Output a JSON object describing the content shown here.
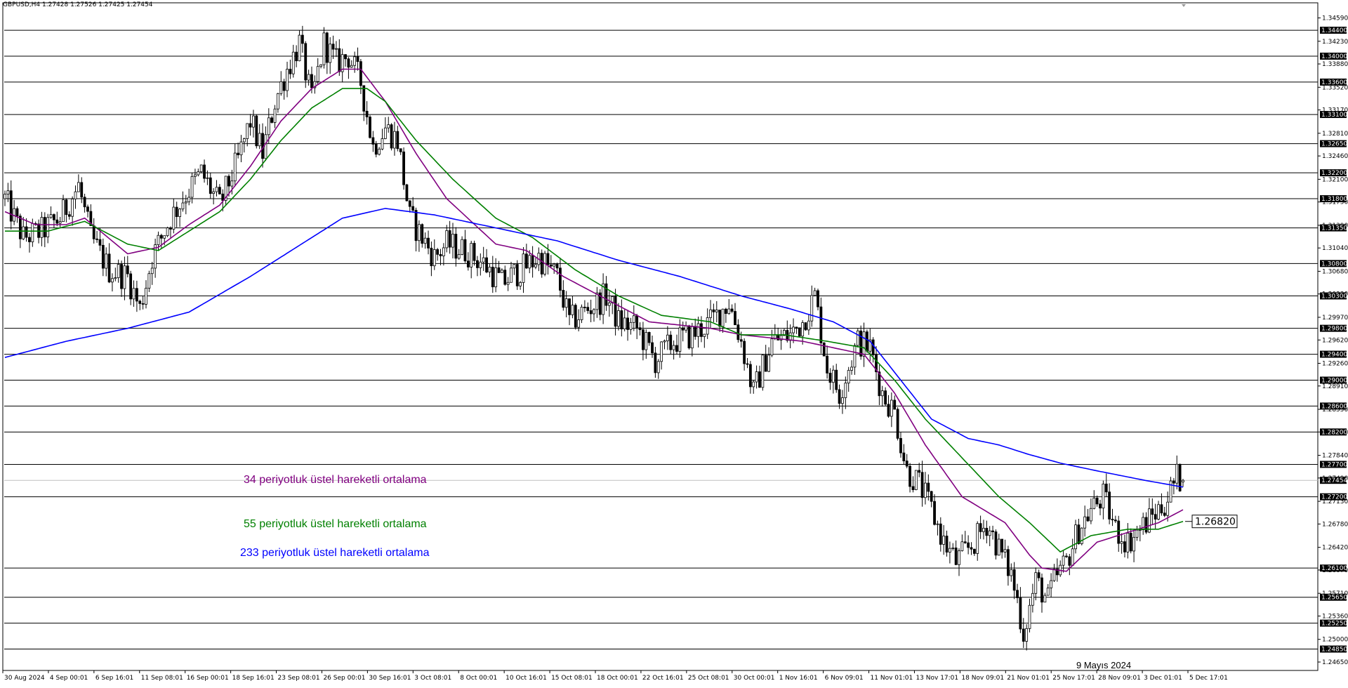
{
  "header": {
    "symbol_line": "GBPUSD,H4  1.27428 1.27526 1.27425 1.27454"
  },
  "annotations": {
    "ema34_label": "34 periyotluk üstel hareketli ortalama",
    "ema55_label": "55 periyotluk üstel hareketli ortalama",
    "ema233_label": "233 periyotluk üstel hareketli ortalama",
    "date_note": "9 Mayıs 2024",
    "price_box": "1.26820"
  },
  "colors": {
    "ema34": "#800080",
    "ema55": "#008000",
    "ema233": "#0000ff",
    "candles": "#000000",
    "grid": "#000000",
    "background": "#ffffff"
  },
  "chart_data": {
    "type": "candlestick",
    "instrument": "GBPUSD",
    "timeframe": "H4",
    "last_quote": {
      "open": 1.27428,
      "high": 1.27526,
      "low": 1.27425,
      "close": 1.27454
    },
    "ylim": [
      1.2465,
      1.3465
    ],
    "y_ticks": [
      "1.34590",
      "1.34230",
      "1.33880",
      "1.33520",
      "1.33170",
      "1.32810",
      "1.32460",
      "1.32100",
      "1.31750",
      "1.31390",
      "1.31040",
      "1.30680",
      "1.30330",
      "1.29970",
      "1.29620",
      "1.29260",
      "1.28910",
      "1.28550",
      "1.28200",
      "1.27840",
      "1.27490",
      "1.27130",
      "1.26780",
      "1.26420",
      "1.26070",
      "1.25710",
      "1.25360",
      "1.25000",
      "1.24650"
    ],
    "level_lines": [
      "1.34400",
      "1.34000",
      "1.33600",
      "1.33100",
      "1.32650",
      "1.32200",
      "1.31800",
      "1.31350",
      "1.30800",
      "1.30300",
      "1.29800",
      "1.29400",
      "1.29000",
      "1.28600",
      "1.28200",
      "1.27700",
      "1.27200",
      "1.26100",
      "1.25650",
      "1.25250",
      "1.24850"
    ],
    "current_price": "1.27454",
    "x_labels": [
      "30 Aug 2024",
      "4 Sep 00:01",
      "6 Sep 16:01",
      "11 Sep 08:01",
      "16 Sep 00:01",
      "18 Sep 16:01",
      "23 Sep 08:01",
      "26 Sep 00:01",
      "30 Sep 16:01",
      "3 Oct 08:01",
      "8 Oct 00:01",
      "10 Oct 16:01",
      "15 Oct 08:01",
      "18 Oct 00:01",
      "22 Oct 16:01",
      "25 Oct 08:01",
      "30 Oct 00:01",
      "1 Nov 16:01",
      "6 Nov 09:01",
      "11 Nov 01:01",
      "13 Nov 17:01",
      "18 Nov 09:01",
      "21 Nov 01:01",
      "25 Nov 17:01",
      "28 Nov 09:01",
      "3 Dec 01:01",
      "5 Dec 17:01"
    ],
    "close_path": [
      [
        0,
        1.318
      ],
      [
        6,
        1.312
      ],
      [
        12,
        1.313
      ],
      [
        18,
        1.315
      ],
      [
        24,
        1.32
      ],
      [
        28,
        1.312
      ],
      [
        34,
        1.307
      ],
      [
        40,
        1.306
      ],
      [
        44,
        1.301
      ],
      [
        48,
        1.309
      ],
      [
        54,
        1.315
      ],
      [
        58,
        1.318
      ],
      [
        64,
        1.322
      ],
      [
        70,
        1.317
      ],
      [
        76,
        1.324
      ],
      [
        80,
        1.33
      ],
      [
        84,
        1.325
      ],
      [
        88,
        1.333
      ],
      [
        92,
        1.338
      ],
      [
        96,
        1.342
      ],
      [
        100,
        1.333
      ],
      [
        104,
        1.342
      ],
      [
        108,
        1.339
      ],
      [
        112,
        1.34
      ],
      [
        116,
        1.336
      ],
      [
        120,
        1.326
      ],
      [
        124,
        1.329
      ],
      [
        128,
        1.327
      ],
      [
        132,
        1.315
      ],
      [
        136,
        1.312
      ],
      [
        140,
        1.309
      ],
      [
        144,
        1.311
      ],
      [
        150,
        1.31
      ],
      [
        156,
        1.308
      ],
      [
        162,
        1.305
      ],
      [
        168,
        1.307
      ],
      [
        174,
        1.309
      ],
      [
        180,
        1.306
      ],
      [
        184,
        1.299
      ],
      [
        190,
        1.301
      ],
      [
        196,
        1.303
      ],
      [
        200,
        1.299
      ],
      [
        206,
        1.298
      ],
      [
        212,
        1.293
      ],
      [
        218,
        1.296
      ],
      [
        224,
        1.297
      ],
      [
        230,
        1.299
      ],
      [
        236,
        1.302
      ],
      [
        240,
        1.296
      ],
      [
        244,
        1.288
      ],
      [
        250,
        1.296
      ],
      [
        256,
        1.297
      ],
      [
        260,
        1.299
      ],
      [
        264,
        1.303
      ],
      [
        268,
        1.292
      ],
      [
        272,
        1.288
      ],
      [
        278,
        1.296
      ],
      [
        282,
        1.295
      ],
      [
        286,
        1.288
      ],
      [
        290,
        1.285
      ],
      [
        294,
        1.276
      ],
      [
        298,
        1.274
      ],
      [
        302,
        1.27
      ],
      [
        306,
        1.265
      ],
      [
        310,
        1.262
      ],
      [
        316,
        1.265
      ],
      [
        320,
        1.268
      ],
      [
        324,
        1.264
      ],
      [
        328,
        1.26
      ],
      [
        330,
        1.256
      ],
      [
        332,
        1.251
      ],
      [
        336,
        1.259
      ],
      [
        340,
        1.256
      ],
      [
        342,
        1.259
      ],
      [
        346,
        1.262
      ],
      [
        350,
        1.267
      ],
      [
        354,
        1.27
      ],
      [
        358,
        1.272
      ],
      [
        362,
        1.267
      ],
      [
        366,
        1.265
      ],
      [
        370,
        1.267
      ],
      [
        374,
        1.269
      ],
      [
        378,
        1.271
      ],
      [
        382,
        1.275
      ],
      [
        384,
        1.2745
      ]
    ],
    "series": [
      {
        "name": "34 periyotluk üstel hareketli ortalama",
        "color": "#800080",
        "values": [
          [
            0,
            1.316
          ],
          [
            10,
            1.314
          ],
          [
            20,
            1.314
          ],
          [
            26,
            1.315
          ],
          [
            40,
            1.3095
          ],
          [
            50,
            1.3105
          ],
          [
            60,
            1.314
          ],
          [
            70,
            1.317
          ],
          [
            80,
            1.323
          ],
          [
            90,
            1.33
          ],
          [
            100,
            1.335
          ],
          [
            110,
            1.338
          ],
          [
            116,
            1.338
          ],
          [
            124,
            1.333
          ],
          [
            134,
            1.325
          ],
          [
            144,
            1.318
          ],
          [
            160,
            1.311
          ],
          [
            170,
            1.31
          ],
          [
            182,
            1.306
          ],
          [
            194,
            1.303
          ],
          [
            210,
            1.299
          ],
          [
            230,
            1.298
          ],
          [
            240,
            1.297
          ],
          [
            260,
            1.296
          ],
          [
            270,
            1.295
          ],
          [
            280,
            1.294
          ],
          [
            290,
            1.288
          ],
          [
            300,
            1.28
          ],
          [
            312,
            1.272
          ],
          [
            326,
            1.268
          ],
          [
            334,
            1.263
          ],
          [
            338,
            1.261
          ],
          [
            346,
            1.2605
          ],
          [
            356,
            1.265
          ],
          [
            366,
            1.2665
          ],
          [
            376,
            1.268
          ],
          [
            384,
            1.27
          ]
        ]
      },
      {
        "name": "55 periyotluk üstel hareketli ortalama",
        "color": "#008000",
        "values": [
          [
            0,
            1.313
          ],
          [
            14,
            1.313
          ],
          [
            26,
            1.3145
          ],
          [
            40,
            1.311
          ],
          [
            50,
            1.31
          ],
          [
            60,
            1.313
          ],
          [
            70,
            1.316
          ],
          [
            80,
            1.321
          ],
          [
            90,
            1.327
          ],
          [
            100,
            1.332
          ],
          [
            110,
            1.335
          ],
          [
            118,
            1.335
          ],
          [
            124,
            1.333
          ],
          [
            134,
            1.327
          ],
          [
            146,
            1.321
          ],
          [
            160,
            1.315
          ],
          [
            172,
            1.312
          ],
          [
            186,
            1.307
          ],
          [
            200,
            1.303
          ],
          [
            214,
            1.3
          ],
          [
            230,
            1.299
          ],
          [
            240,
            1.297
          ],
          [
            254,
            1.297
          ],
          [
            268,
            1.296
          ],
          [
            280,
            1.295
          ],
          [
            290,
            1.29
          ],
          [
            300,
            1.284
          ],
          [
            312,
            1.278
          ],
          [
            324,
            1.272
          ],
          [
            334,
            1.268
          ],
          [
            344,
            1.2635
          ],
          [
            354,
            1.266
          ],
          [
            366,
            1.267
          ],
          [
            376,
            1.267
          ],
          [
            384,
            1.2682
          ]
        ]
      },
      {
        "name": "233 periyotluk üstel hareketli ortalama",
        "color": "#0000ff",
        "values": [
          [
            0,
            1.2935
          ],
          [
            20,
            1.296
          ],
          [
            40,
            1.298
          ],
          [
            60,
            1.3005
          ],
          [
            80,
            1.306
          ],
          [
            100,
            1.312
          ],
          [
            110,
            1.315
          ],
          [
            124,
            1.3165
          ],
          [
            140,
            1.3155
          ],
          [
            160,
            1.3135
          ],
          [
            180,
            1.3115
          ],
          [
            200,
            1.3085
          ],
          [
            220,
            1.306
          ],
          [
            240,
            1.303
          ],
          [
            256,
            1.301
          ],
          [
            270,
            1.299
          ],
          [
            282,
            1.296
          ],
          [
            292,
            1.29
          ],
          [
            302,
            1.284
          ],
          [
            314,
            1.281
          ],
          [
            324,
            1.28
          ],
          [
            334,
            1.2785
          ],
          [
            344,
            1.2772
          ],
          [
            356,
            1.276
          ],
          [
            372,
            1.2745
          ],
          [
            384,
            1.2735
          ]
        ]
      }
    ],
    "grid": false,
    "legend": "none"
  }
}
